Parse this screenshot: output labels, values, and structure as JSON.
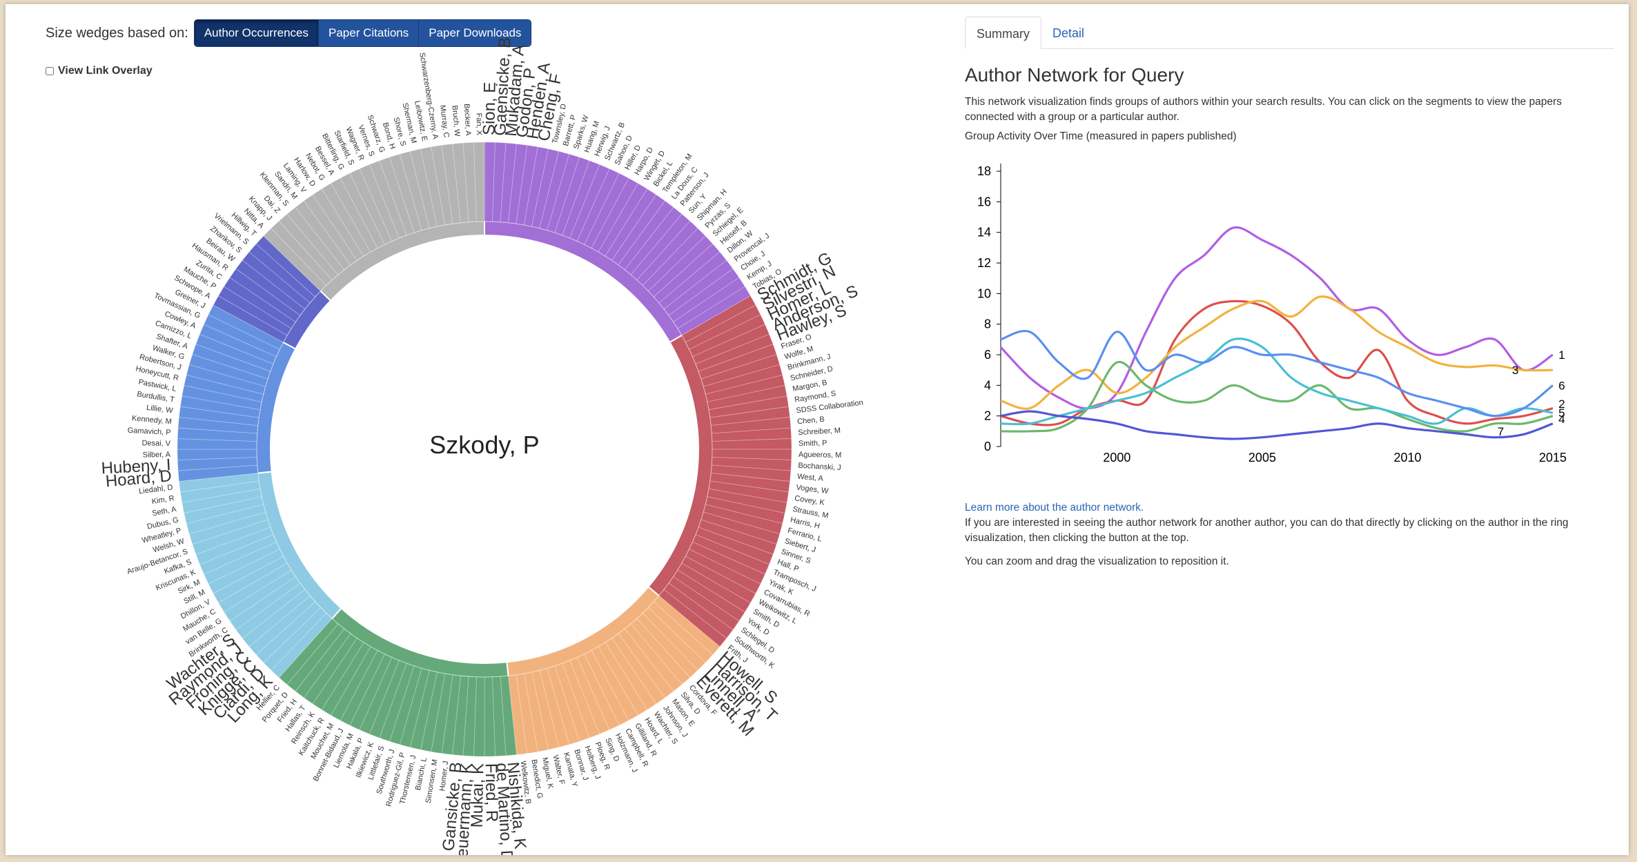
{
  "controls": {
    "size_label": "Size wedges based on:",
    "buttons": [
      {
        "label": "Author Occurrences",
        "active": true
      },
      {
        "label": "Paper Citations",
        "active": false
      },
      {
        "label": "Paper Downloads",
        "active": false
      }
    ],
    "overlay_label": "View Link Overlay",
    "overlay_checked": false
  },
  "ring": {
    "center_label": "Szkody, P",
    "groups": [
      {
        "id": 1,
        "color": "#a16fd6",
        "featured": [
          "Sion, E",
          "Gaensicke, B",
          "Mukadam, A",
          "Godon, P",
          "Henden, A",
          "Cheng, F"
        ],
        "authors": [
          "Townsley, D",
          "Barrett, P",
          "Sparks, W",
          "Huang, M",
          "Herwig, J",
          "Schwartz, B",
          "Sahoo, D",
          "Hiller, D",
          "Harpo, D",
          "Winget, D",
          "Bickel, L",
          "Templeton, M",
          "La Dous, C",
          "Patterson, J",
          "Sun, Y",
          "Shipman, H",
          "Pyrzas, S",
          "Schiegel, E",
          "Heiself, B",
          "Dillon, W",
          "Provencal, J",
          "Choie, J",
          "Kemp, J",
          "Tobias, O"
        ]
      },
      {
        "id": 2,
        "color": "#c45a63",
        "featured": [
          "Schmidt, G",
          "Silvestri, N",
          "Homer, L",
          "Anderson, S",
          "Hawley, S"
        ],
        "authors": [
          "Fraser, O",
          "Wolfe, M",
          "Brinkmann, J",
          "Schneider, D",
          "Margon, B",
          "Raymond, S",
          "SDSS Collaboration",
          "Chen, B",
          "Schreiber, M",
          "Smith, P",
          "Agueeros, M",
          "Bochanski, J",
          "West, A",
          "Voges, W",
          "Covey, K",
          "Strauss, M",
          "Harris, H",
          "Ferrario, L",
          "Siebert, J",
          "Sinner, S",
          "Hall, P",
          "Tramposch, J",
          "Yirak, K",
          "Covarrubias, R",
          "Weikowitz, L",
          "Smith, D",
          "York, D",
          "Schlegel, D",
          "Southworth, K",
          "Frith, J"
        ]
      },
      {
        "id": 3,
        "color": "#f2b27e",
        "featured": [
          "Howell, S",
          "Harrison, T",
          "Linnell, A",
          "Everett, M"
        ],
        "authors": [
          "Cordova, F",
          "Silva, D",
          "Mason, E",
          "Johnson, J",
          "Wachter, S",
          "Hoard, L",
          "Gilliland, R",
          "Campbell, R",
          "Holzmann, J",
          "Sing, D",
          "Ploeg, R",
          "Holberg, J",
          "Bonnar, J",
          "Kamata, Y",
          "Walter, F",
          "Miguel, K",
          "Benedict, G",
          "Welkowitz, B"
        ]
      },
      {
        "id": 4,
        "color": "#65a97a",
        "featured": [
          "Nishikida, K",
          "de Martino, D",
          "Fried, R",
          "Mukai, K",
          "Beuermann, K",
          "Gansicke, B"
        ],
        "authors": [
          "Homer, J",
          "Simonsen, M",
          "Bianchi, L",
          "Thorstensen, J",
          "Rodriguez-Gil, P",
          "Southworth, J",
          "Littlefair, S",
          "Ilkiewicz, K",
          "Hakala, P",
          "Liemola, M",
          "Bonnet-Bidaud, J",
          "Mouchet, M",
          "Kaitchuck, R",
          "Reinsch, K",
          "Hallas, T",
          "Fried, H",
          "Porquet, D",
          "Hellier, C"
        ]
      },
      {
        "id": 5,
        "color": "#8ecae4",
        "featured": [
          "Long, K",
          "Ciardi, D",
          "Knigge, C",
          "Froning, C",
          "Raymond, J",
          "Wachter, S"
        ],
        "authors": [
          "Brinkworth, C",
          "van Belle, G",
          "Mauche, C",
          "Dhillon, V",
          "Still, M",
          "Sirk, M",
          "Kriscunas, K",
          "Kafka, S",
          "Araujo-Betancor, S",
          "Welsh, W",
          "Wheatley, P",
          "Dubus, G",
          "Seth, A",
          "Kim, R",
          "Liedahl, D"
        ]
      },
      {
        "id": 6,
        "color": "#6592e0",
        "featured": [
          "Hoard, D",
          "Hubeny, I"
        ],
        "authors": [
          "Silber, A",
          "Desai, V",
          "Gamavich, P",
          "Kennedy, M",
          "Lillie, W",
          "Burdullis, T",
          "Pastwick, L",
          "Honeycutt, R",
          "Robertson, J",
          "Walker, G",
          "Shafter, A",
          "Carnizzo, L",
          "Cowley, A",
          "Tovmassian, G",
          "Greiner, J"
        ]
      },
      {
        "id": 7,
        "color": "#6268c9",
        "featured": [],
        "authors": [
          "Schwope, A",
          "Mauche, P",
          "Zurita, C",
          "Hausman, R",
          "Beirau, W",
          "Zharikov, S",
          "Vrielmann, S",
          "Hillwig, T"
        ]
      },
      {
        "id": 8,
        "color": "#b4b4b4",
        "featured": [],
        "authors": [
          "Nitta, A",
          "Knapp, J",
          "Dai, Z",
          "Kleinman, S",
          "Sandri, M",
          "Laming, V",
          "Harlow, D",
          "Nebot, G",
          "Bessel, A",
          "Bitterling, G",
          "Starfield, S",
          "Wagner, R",
          "Vernes, S",
          "Schwarz, G",
          "Bond, H",
          "Shore, S",
          "Sherman, M",
          "Leibowitz, E",
          "Schwarzenberg-Czerny, A",
          "Murray, C",
          "Bruch, W",
          "Becker, A",
          "Fan, X"
        ]
      }
    ]
  },
  "panel": {
    "tabs": [
      {
        "label": "Summary",
        "active": true
      },
      {
        "label": "Detail",
        "active": false
      }
    ],
    "title": "Author Network for Query",
    "description": "This network visualization finds groups of authors within your search results. You can click on the segments to view the papers connected with a group or a particular author.",
    "chart_caption": "Group Activity Over Time (measured in papers published)",
    "learn_more": "Learn more about the author network.",
    "help_1": "If you are interested in seeing the author network for another author, you can do that directly by clicking on the author in the ring visualization, then clicking the button at the top.",
    "help_2": "You can zoom and drag the visualization to reposition it."
  },
  "chart_data": {
    "type": "line",
    "title": "Group Activity Over Time (measured in papers published)",
    "xlabel": "",
    "ylabel": "",
    "x": [
      1996,
      1997,
      1998,
      1999,
      2000,
      2001,
      2002,
      2003,
      2004,
      2005,
      2006,
      2007,
      2008,
      2009,
      2010,
      2011,
      2012,
      2013,
      2014,
      2015
    ],
    "xticks": [
      2000,
      2005,
      2010,
      2015
    ],
    "yticks": [
      0,
      2,
      4,
      6,
      8,
      10,
      12,
      14,
      16,
      18
    ],
    "ylim": [
      0,
      18.5
    ],
    "xlim": [
      1996,
      2015
    ],
    "series": [
      {
        "name": "1",
        "color": "#b15ee3",
        "values": [
          6.5,
          4.5,
          3.2,
          2.5,
          3.5,
          7.5,
          11.0,
          12.5,
          14.3,
          13.5,
          12.5,
          11.0,
          9.0,
          9.0,
          7.0,
          6.0,
          6.5,
          7.0,
          5.0,
          6.0
        ]
      },
      {
        "name": "2",
        "color": "#de4f4a",
        "values": [
          2.0,
          1.5,
          1.5,
          2.5,
          3.0,
          3.0,
          7.0,
          9.0,
          9.5,
          9.2,
          8.0,
          5.5,
          4.5,
          6.3,
          3.0,
          2.0,
          1.5,
          1.8,
          2.0,
          2.5
        ]
      },
      {
        "name": "3",
        "color": "#f2b23d",
        "values": [
          3.0,
          2.5,
          4.0,
          5.0,
          3.5,
          4.5,
          6.5,
          7.8,
          9.0,
          9.5,
          8.5,
          9.8,
          9.0,
          7.5,
          6.5,
          5.5,
          5.2,
          5.3,
          5.0,
          5.0
        ]
      },
      {
        "name": "4",
        "color": "#6cb86c",
        "values": [
          1.0,
          1.0,
          1.2,
          2.5,
          5.5,
          4.0,
          3.0,
          3.0,
          4.0,
          3.2,
          3.0,
          4.0,
          2.5,
          2.5,
          1.8,
          1.2,
          1.0,
          1.5,
          1.5,
          2.0
        ]
      },
      {
        "name": "5",
        "color": "#47c0d4",
        "values": [
          1.5,
          1.5,
          2.0,
          2.5,
          3.0,
          3.5,
          4.5,
          5.5,
          7.0,
          6.5,
          4.5,
          3.5,
          3.0,
          2.5,
          2.0,
          1.5,
          2.5,
          2.0,
          2.5,
          2.2
        ]
      },
      {
        "name": "6",
        "color": "#5a8ff0",
        "values": [
          7.0,
          7.5,
          5.5,
          4.5,
          7.5,
          5.0,
          6.0,
          5.5,
          6.5,
          6.0,
          6.0,
          5.5,
          5.0,
          4.5,
          3.5,
          3.0,
          2.5,
          2.0,
          2.5,
          4.0
        ]
      },
      {
        "name": "7",
        "color": "#5057d6",
        "values": [
          2.0,
          2.3,
          2.0,
          1.8,
          1.5,
          1.0,
          0.8,
          0.6,
          0.5,
          0.6,
          0.8,
          1.0,
          1.2,
          1.5,
          1.2,
          1.0,
          0.8,
          0.6,
          0.8,
          1.5
        ]
      }
    ],
    "end_labels": [
      {
        "text": "1",
        "x": 2015.1,
        "y": 6.0
      },
      {
        "text": "3",
        "x": 2013.5,
        "y": 5.0
      },
      {
        "text": "6",
        "x": 2015.1,
        "y": 4.0
      },
      {
        "text": "2",
        "x": 2015.1,
        "y": 2.8
      },
      {
        "text": "5",
        "x": 2015.1,
        "y": 2.2
      },
      {
        "text": "4",
        "x": 2015.1,
        "y": 1.8
      },
      {
        "text": "7",
        "x": 2013.0,
        "y": 1.0
      }
    ]
  }
}
